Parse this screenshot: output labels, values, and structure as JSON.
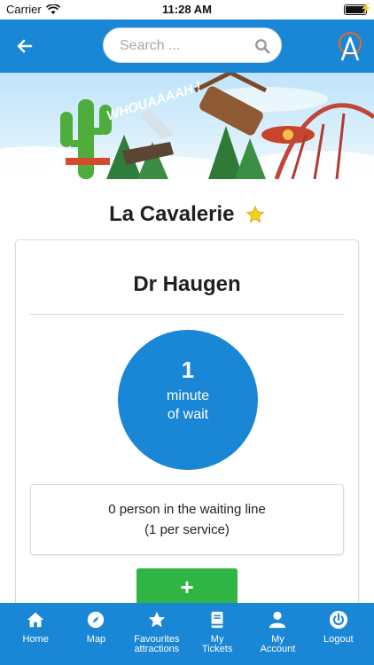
{
  "status_bar": {
    "carrier": "Carrier",
    "time": "11:28 AM"
  },
  "header": {
    "search_placeholder": "Search ...",
    "brand_color": "#1a86d6"
  },
  "banner": {
    "caption": "WHOUAAAAH !"
  },
  "attraction": {
    "park_name": "La Cavalerie",
    "ride_name": "Dr Haugen",
    "wait_value": "1",
    "wait_unit": "minute",
    "wait_suffix": "of wait",
    "queue_line1": "0 person in the waiting line",
    "queue_line2": "(1 per service)",
    "add_label": "+"
  },
  "nav": {
    "items": [
      {
        "label": "Home",
        "icon": "home-icon"
      },
      {
        "label": "Map",
        "icon": "compass-icon"
      },
      {
        "label1": "Favourites",
        "label2": "attractions",
        "icon": "star-icon"
      },
      {
        "label1": "My",
        "label2": "Tickets",
        "icon": "book-icon"
      },
      {
        "label1": "My",
        "label2": "Account",
        "icon": "user-icon"
      },
      {
        "label": "Logout",
        "icon": "power-icon"
      }
    ]
  }
}
